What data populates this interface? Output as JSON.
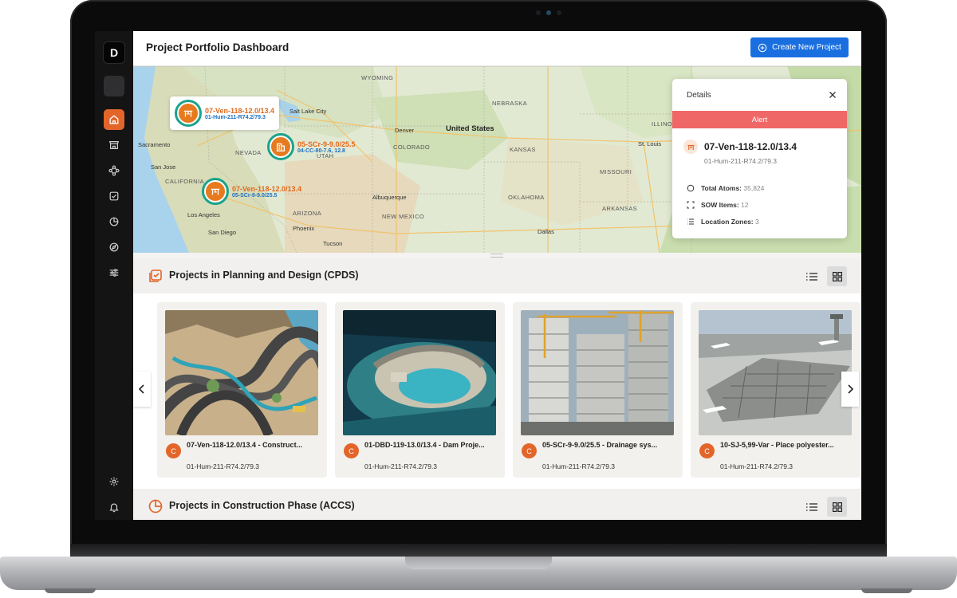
{
  "app": {
    "logo_letter": "D",
    "page_title": "Project Portfolio Dashboard",
    "create_button": "Create New Project"
  },
  "sidebar": {
    "items": [
      {
        "icon": "home-icon",
        "active": true
      },
      {
        "icon": "store-icon",
        "active": false
      },
      {
        "icon": "nodes-icon",
        "active": false
      },
      {
        "icon": "checklist-icon",
        "active": false
      },
      {
        "icon": "pie-chart-icon",
        "active": false
      },
      {
        "icon": "compass-icon",
        "active": false
      },
      {
        "icon": "sliders-icon",
        "active": false
      }
    ],
    "bottom_items": [
      {
        "icon": "gear-icon"
      },
      {
        "icon": "bell-icon"
      }
    ]
  },
  "map": {
    "region_labels": [
      "WYOMING",
      "NEBRASKA",
      "COLORADO",
      "KANSAS",
      "NEW MEXICO",
      "CALIFORNIA",
      "ARIZONA",
      "UTAH",
      "ILLINOIS",
      "MISSOURI",
      "OKLAHOMA",
      "ARKANSAS",
      "NEVADA"
    ],
    "cities": [
      "Salt Lake City",
      "Sacramento",
      "San Jose",
      "Los Angeles",
      "San Diego",
      "Phoenix",
      "Tucson",
      "Albuquerque",
      "Denver",
      "Dallas",
      "St. Louis"
    ],
    "country_label": "United States",
    "markers": [
      {
        "title": "07-Ven-118-12.0/13.4",
        "subtitle": "01-Hum-211-R74.2/79.3"
      },
      {
        "title": "05-SCr-9-9.0/25.5",
        "subtitle": "04-CC-80-7.6, 12.8"
      },
      {
        "title": "07-Ven-118-12.0/13.4",
        "subtitle": "05-SCr-9-9.0/25.5"
      }
    ]
  },
  "details_panel": {
    "header": "Details",
    "alert": "Alert",
    "title": "07-Ven-118-12.0/13.4",
    "subtitle": "01-Hum-211-R74.2/79.3",
    "stats": [
      {
        "label": "Total Atoms:",
        "value": "35,824",
        "icon": "circle-icon"
      },
      {
        "label": "SOW Items:",
        "value": "12",
        "icon": "scan-icon"
      },
      {
        "label": "Location Zones:",
        "value": "3",
        "icon": "list-icon"
      }
    ]
  },
  "sections": [
    {
      "title": "Projects in Planning and Design (CPDS)",
      "icon": "checklist-icon"
    },
    {
      "title": "Projects in Construction Phase (ACCS)",
      "icon": "pie-chart-icon"
    }
  ],
  "cards": [
    {
      "badge": "C",
      "title": "07-Ven-118-12.0/13.4 - Construct...",
      "subtitle": "01-Hum-211-R74.2/79.3",
      "image": "highway-interchange"
    },
    {
      "badge": "C",
      "title": "01-DBD-119-13.0/13.4 - Dam Proje...",
      "subtitle": "01-Hum-211-R74.2/79.3",
      "image": "dam-project"
    },
    {
      "badge": "C",
      "title": "05-SCr-9-9.0/25.5 - Drainage sys...",
      "subtitle": "01-Hum-211-R74.2/79.3",
      "image": "building-construction"
    },
    {
      "badge": "C",
      "title": "10-SJ-5,99-Var - Place polyester...",
      "subtitle": "01-Hum-211-R74.2/79.3",
      "image": "airport-construction"
    }
  ],
  "colors": {
    "accent": "#e3652a",
    "primary_button": "#1a6fe0",
    "alert": "#ef6766",
    "marker_ring": "#1aa38b"
  }
}
